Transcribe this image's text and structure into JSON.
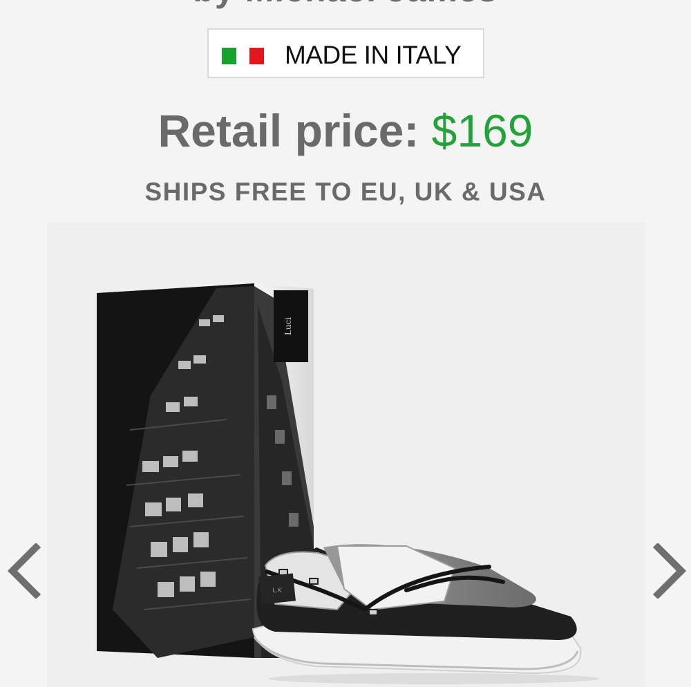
{
  "header": {
    "designer_line": "by Michael James"
  },
  "badge": {
    "label": "MADE IN ITALY",
    "flag_icon": "italy-flag-icon",
    "flag_colors": [
      "#17a22e",
      "#ffffff",
      "#e3161e"
    ]
  },
  "price": {
    "label": "Retail price:",
    "amount": "$169",
    "amount_color": "#22a33a"
  },
  "shipping": {
    "text": "SHIPS FREE TO EU, UK & USA"
  },
  "gallery": {
    "prev_icon": "chevron-left-icon",
    "next_icon": "chevron-right-icon",
    "image": "shoe-and-box-image"
  }
}
